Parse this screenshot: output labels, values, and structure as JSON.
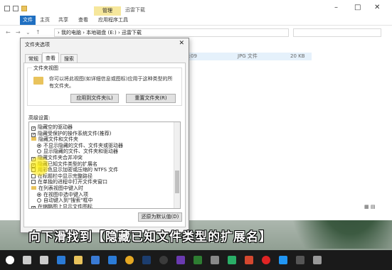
{
  "explorer": {
    "manage_tab": "管理",
    "window_title": "迅雷下载",
    "ribbon_tabs": [
      "文件",
      "主页",
      "共享",
      "查看",
      "应用程序工具"
    ],
    "breadcrumb": "›  我的电脑  ›  本地磁盘 (E:)  ›  迅雷下载",
    "file_row": {
      "date": "20/9/7 13:09",
      "type": "JPG 文件",
      "size": "20 KB"
    }
  },
  "dialog": {
    "title": "文件夹选项",
    "tabs": [
      "常规",
      "查看",
      "搜索"
    ],
    "folder_view_label": "文件夹视图",
    "folder_view_desc": "你可以将此视图(如详细信息或图标)应用于这种类型的所有文件夹。",
    "apply_button": "应用到文件夹(L)",
    "reset_button": "重置文件夹(R)",
    "advanced_label": "高级设置:",
    "tree_items": [
      {
        "kind": "cb",
        "checked": true,
        "indent": 0,
        "label": "隐藏空的驱动器"
      },
      {
        "kind": "cb",
        "checked": true,
        "indent": 0,
        "label": "隐藏受保护的操作系统文件(推荐)"
      },
      {
        "kind": "folder",
        "indent": 0,
        "label": "隐藏文件和文件夹"
      },
      {
        "kind": "rb",
        "checked": true,
        "indent": 1,
        "label": "不显示隐藏的文件、文件夹或驱动器"
      },
      {
        "kind": "rb",
        "checked": false,
        "indent": 1,
        "label": "显示隐藏的文件、文件夹和驱动器"
      },
      {
        "kind": "cb",
        "checked": true,
        "indent": 0,
        "label": "隐藏文件夹合并冲突"
      },
      {
        "kind": "cb",
        "checked": true,
        "indent": 0,
        "label": "隐藏已知文件类型的扩展名"
      },
      {
        "kind": "cb",
        "checked": false,
        "indent": 0,
        "label": "用彩色显示加密或压缩的 NTFS 文件"
      },
      {
        "kind": "cb",
        "checked": false,
        "indent": 0,
        "label": "在标题栏中显示完整路径"
      },
      {
        "kind": "cb",
        "checked": false,
        "indent": 0,
        "label": "在单独的进程中打开文件夹窗口"
      },
      {
        "kind": "folder",
        "indent": 0,
        "label": "在列表视图中键入时"
      },
      {
        "kind": "rb",
        "checked": true,
        "indent": 1,
        "label": "在视图中选中键入项"
      },
      {
        "kind": "rb",
        "checked": false,
        "indent": 1,
        "label": "自动键入到\"搜索\"框中"
      },
      {
        "kind": "cb",
        "checked": true,
        "indent": 0,
        "label": "在缩略图上显示文件图标"
      }
    ],
    "restore_button": "还原为默认值(D)"
  },
  "caption": "向下滑找到【隐藏已知文件类型的扩展名】",
  "taskbar_icons": [
    "start-icon",
    "search-icon",
    "task-view-icon",
    "edge-icon",
    "explorer-icon",
    "store-icon",
    "mail-icon",
    "chrome-icon",
    "photoshop-icon",
    "obs-icon",
    "app-icon",
    "app-icon",
    "screenshot-icon",
    "wechat-icon",
    "video-icon",
    "record-icon",
    "music-icon",
    "app-icon",
    "app-icon"
  ],
  "taskbar_colors": [
    "#ffffff",
    "#cccccc",
    "#cccccc",
    "#2b7bd6",
    "#e9c35c",
    "#3a7bd5",
    "#2b7bd6",
    "#e5a823",
    "#1c3d6e",
    "#3b3b3b",
    "#6a3ab0",
    "#2e7d32",
    "#888888",
    "#2aae67",
    "#d4482f",
    "#e02424",
    "#2196f3",
    "#555555",
    "#999999"
  ]
}
